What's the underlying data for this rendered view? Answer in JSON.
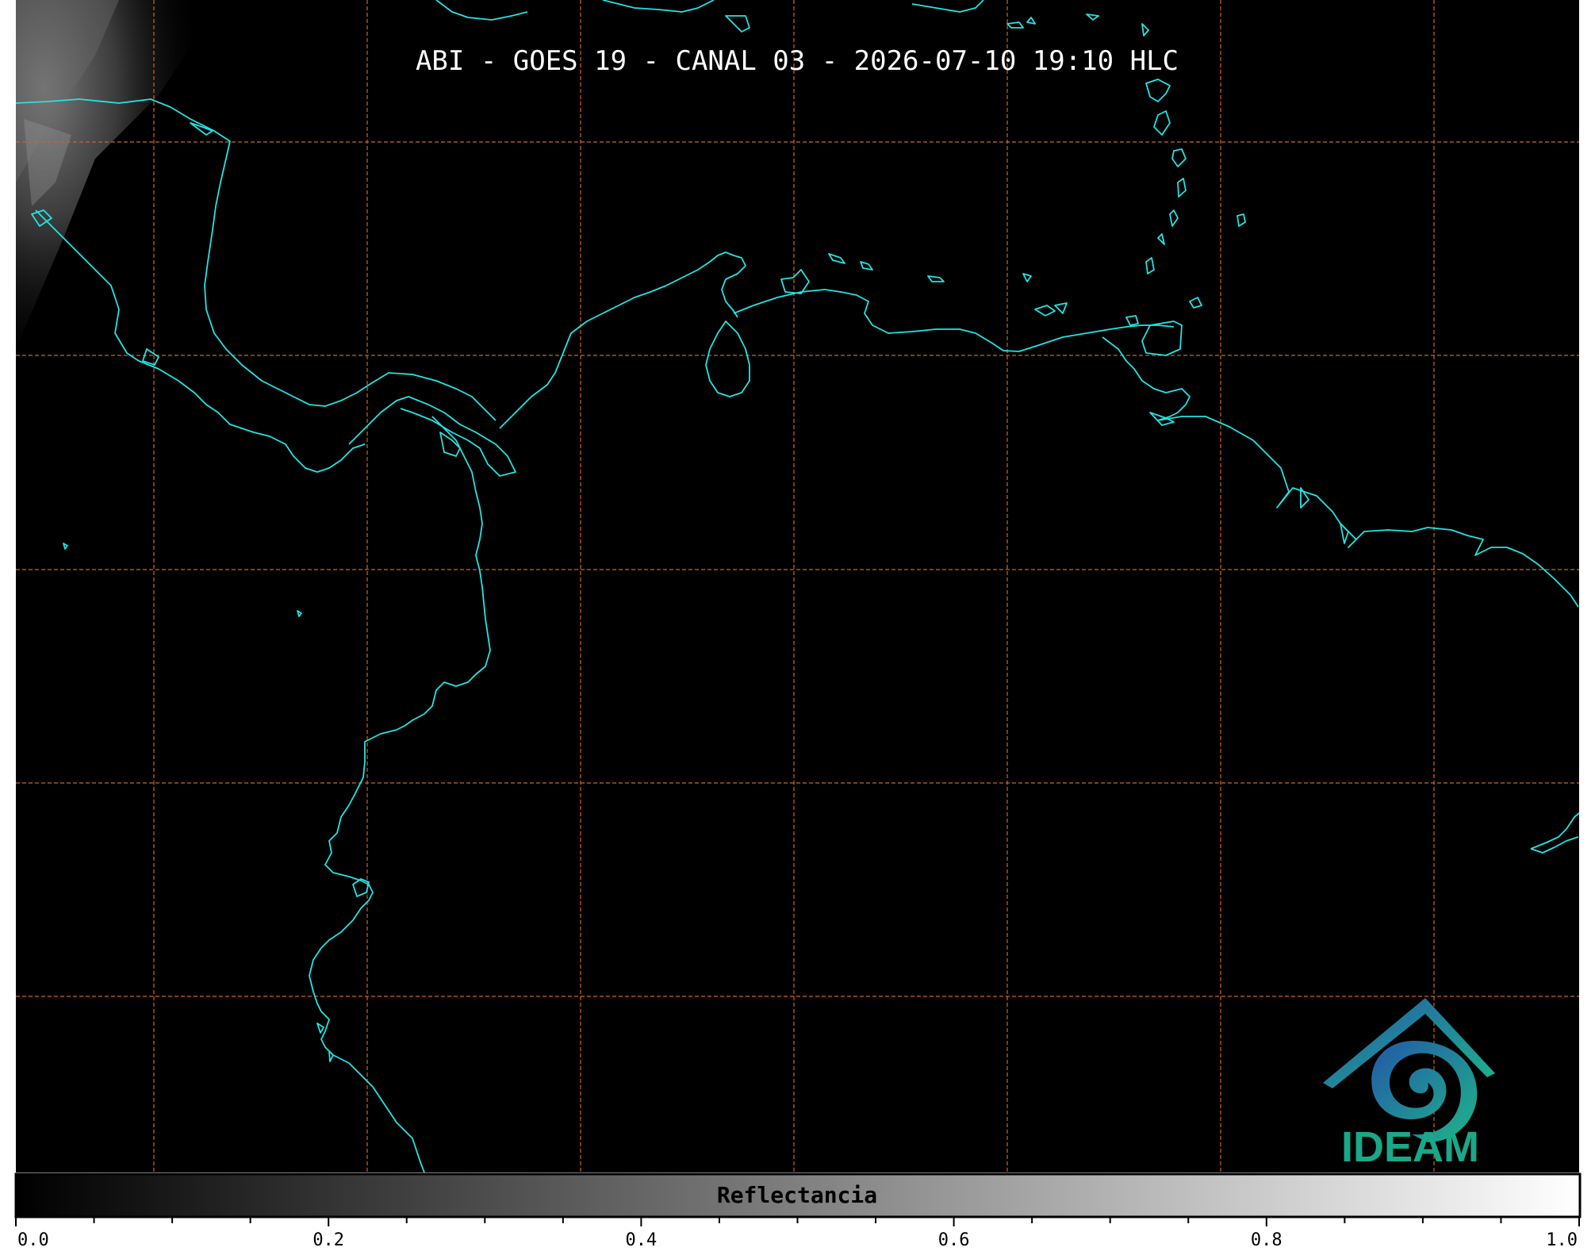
{
  "title": "ABI - GOES 19 - CANAL 03 - 2026-07-10 19:10 HLC",
  "colorbar": {
    "label": "Reflectancia",
    "ticks": [
      "0.0",
      "0.2",
      "0.4",
      "0.6",
      "0.8",
      "1.0"
    ]
  },
  "logo": {
    "text": "IDEAM"
  },
  "colors": {
    "background": "#000000",
    "coastline": "#22e4e4",
    "grid": "#c8662a",
    "title": "#ffffff",
    "logo_blue": "#1f6fb0",
    "logo_teal": "#19a889"
  }
}
